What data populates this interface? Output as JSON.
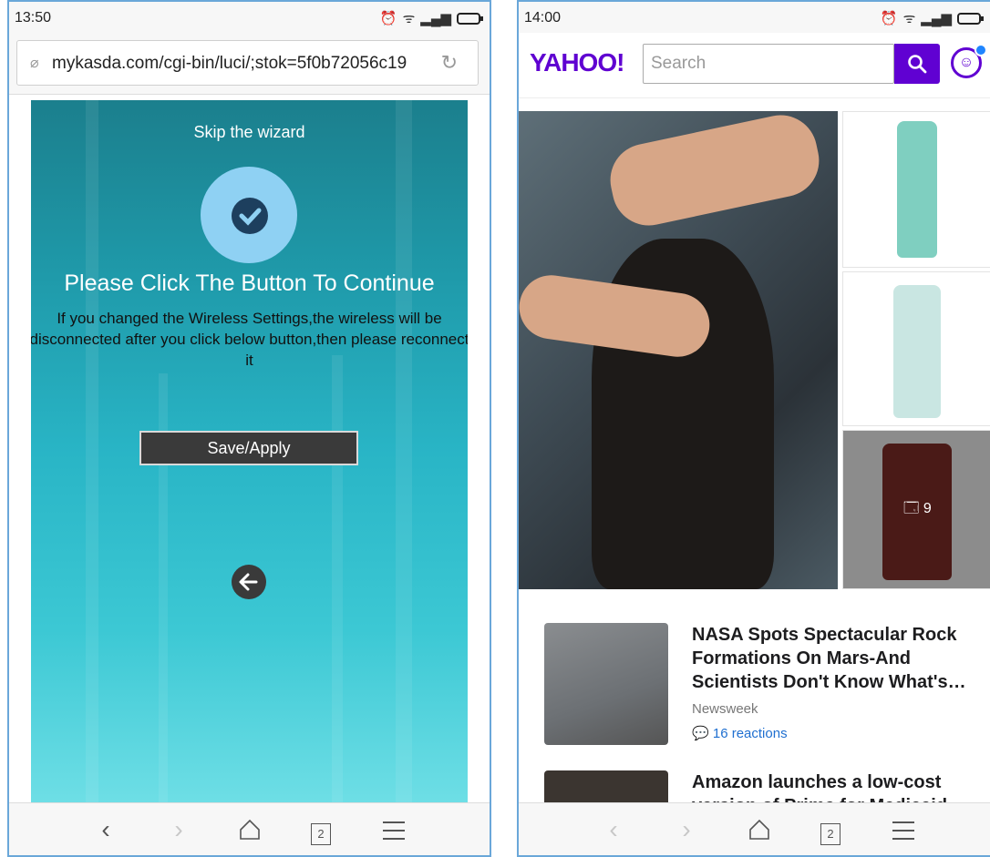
{
  "left": {
    "status": {
      "time": "13:50"
    },
    "address_bar": {
      "url": "mykasda.com/cgi-bin/luci/;stok=5f0b72056c19"
    },
    "wizard": {
      "skip_label": "Skip the wizard",
      "heading": "Please Click The Button To Continue",
      "message": "If you changed the Wireless Settings,the wireless will be disconnected after you click below button,then please reconnect it",
      "save_button": "Save/Apply"
    },
    "navbar": {
      "tabs_count": "2"
    }
  },
  "right": {
    "status": {
      "time": "14:00"
    },
    "header": {
      "logo": "YAHOO!",
      "search_placeholder": "Search"
    },
    "gallery": {
      "photo_count": "9"
    },
    "news": [
      {
        "title": "NASA Spots Spectacular Rock Formations On Mars-And Scientists Don't Know What's…",
        "source": "Newsweek",
        "reactions": "16 reactions"
      },
      {
        "title": "Amazon launches a low-cost version of Prime for Medicaid"
      }
    ],
    "navbar": {
      "tabs_count": "2"
    }
  }
}
